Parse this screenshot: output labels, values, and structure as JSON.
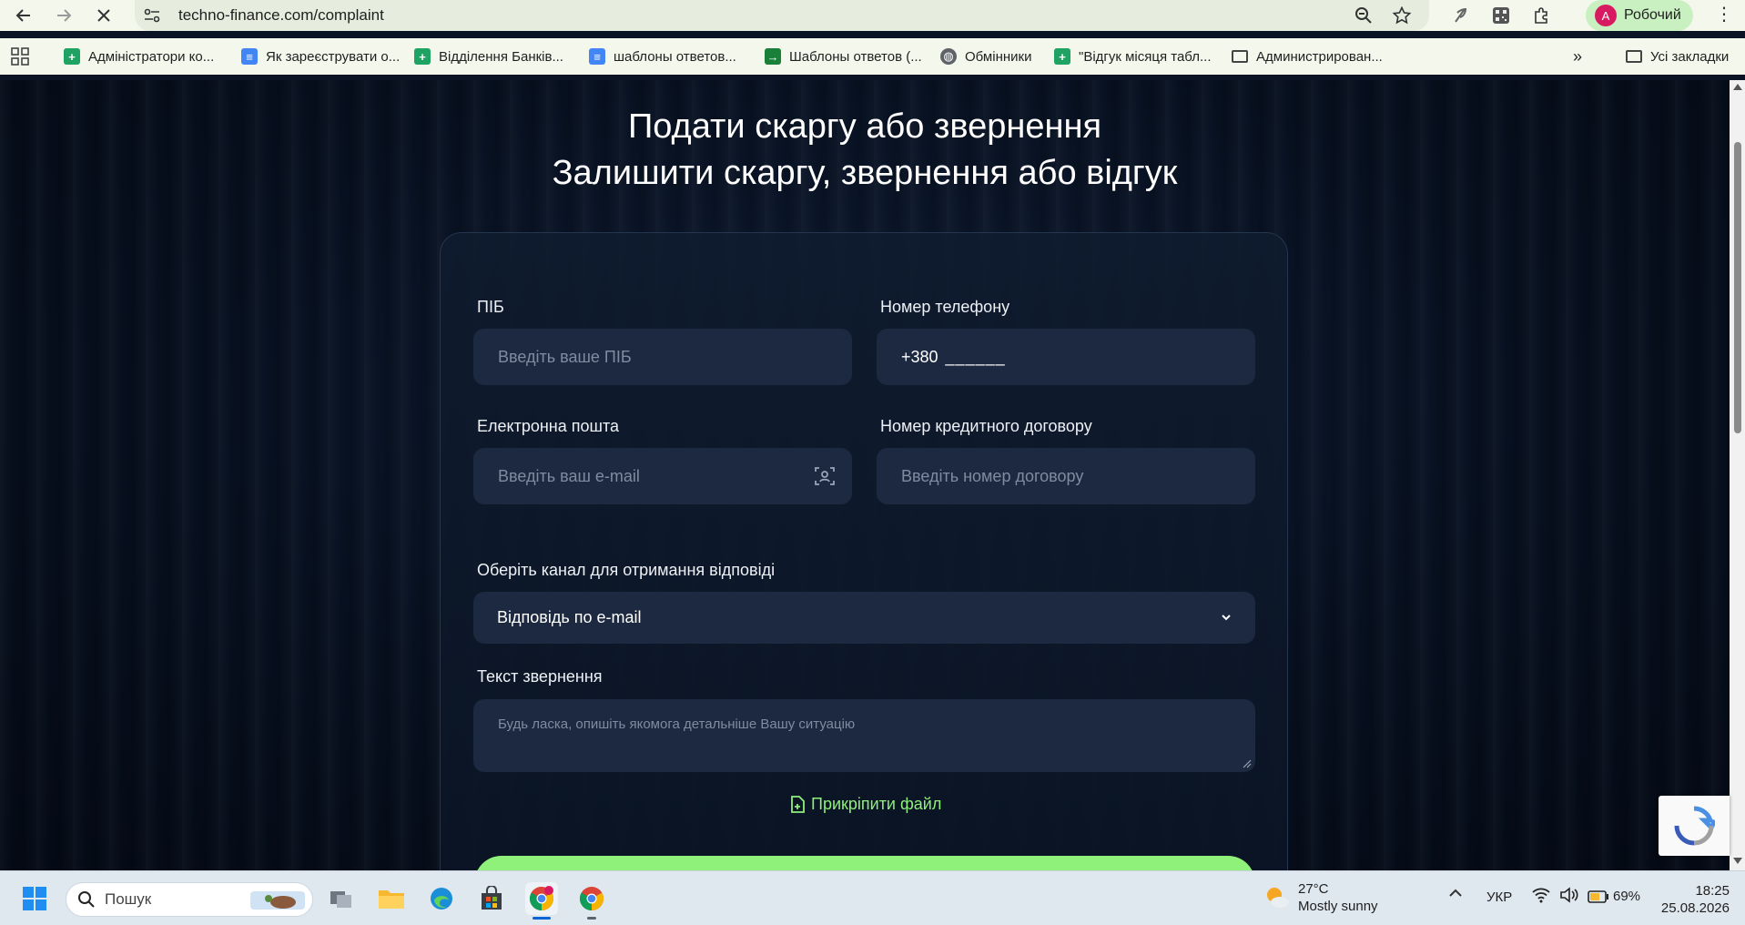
{
  "browser": {
    "url": "techno-finance.com/complaint",
    "profile_initial": "A",
    "profile_name": "Робочий"
  },
  "bookmarks": [
    {
      "label": "Адміністратори ко...",
      "icon": "sheets-icon"
    },
    {
      "label": "Як зареєструвати о...",
      "icon": "docs-icon"
    },
    {
      "label": "Відділення Банків...",
      "icon": "sheets-icon"
    },
    {
      "label": "шаблоны ответов...",
      "icon": "docs-icon"
    },
    {
      "label": "Шаблоны ответов (...",
      "icon": "green-icon"
    },
    {
      "label": "Обмінники",
      "icon": "globe-icon"
    },
    {
      "label": "\"Відгук місяця табл...",
      "icon": "sheets-icon"
    },
    {
      "label": "Администрирован...",
      "icon": "folder-icon"
    }
  ],
  "bookmarks_all": "Усі закладки",
  "page": {
    "title_line1": "Подати скаргу або звернення",
    "title_line2": "Залишити скаргу, звернення або відгук"
  },
  "form": {
    "name_label": "ПІБ",
    "name_placeholder": "Введіть ваше ПІБ",
    "phone_label": "Номер телефону",
    "phone_prefix": "+380",
    "phone_mask": "______",
    "email_label": "Електронна пошта",
    "email_placeholder": "Введіть ваш e-mail",
    "contract_label": "Номер кредитного договору",
    "contract_placeholder": "Введіть номер договору",
    "channel_label": "Оберіть канал для отримання відповіді",
    "channel_selected": "Відповідь по e-mail",
    "text_label": "Текст звернення",
    "text_placeholder": "Будь ласка, опишіть якомога детальніше Вашу ситуацію",
    "attach_label": "Прикріпити файл"
  },
  "colors": {
    "accent": "#8ff07a",
    "field_bg": "#1c2940",
    "page_bg": "#0b1424"
  },
  "taskbar": {
    "search_placeholder": "Пошук",
    "weather_temp": "27°C",
    "weather_desc": "Mostly sunny",
    "language": "УКР",
    "battery": "69%",
    "time": "18:25",
    "date": "25.08.2026"
  }
}
